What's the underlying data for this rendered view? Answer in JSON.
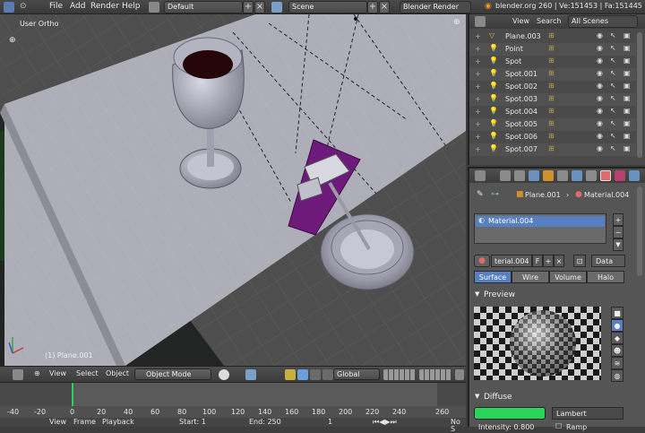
{
  "topbar": {
    "menu": [
      "File",
      "Add",
      "Render",
      "Help"
    ],
    "screen": "Default",
    "scene": "Scene",
    "engine": "Blender Render",
    "stats": "blender.org 260 | Ve:151453 | Fa:151445 | O"
  },
  "viewport": {
    "label": "User Ortho",
    "object_label": "(1) Plane.001"
  },
  "view_toolbar": {
    "items": [
      "View",
      "Select",
      "Object"
    ],
    "mode": "Object Mode",
    "orientation": "Global"
  },
  "timeline": {
    "ticks": [
      "-40",
      "-20",
      "0",
      "20",
      "40",
      "60",
      "80",
      "100",
      "120",
      "140",
      "160",
      "180",
      "200",
      "220",
      "240",
      "260"
    ],
    "items": [
      "View",
      "Frame",
      "Playback"
    ],
    "start": "Start: 1",
    "end": "End: 250",
    "current": "1",
    "no_sync": "No S"
  },
  "outliner": {
    "header": [
      "View",
      "Search"
    ],
    "scenes": "All Scenes",
    "items": [
      "Plane.003",
      "Point",
      "Spot",
      "Spot.001",
      "Spot.002",
      "Spot.003",
      "Spot.004",
      "Spot.005",
      "Spot.006",
      "Spot.007"
    ]
  },
  "properties": {
    "breadcrumb_object": "Plane.001",
    "breadcrumb_material": "Material.004",
    "material_slot": "Material.004",
    "material_name": "terial.004",
    "f_label": "F",
    "data_label": "Data",
    "tabs": [
      "Surface",
      "Wire",
      "Volume",
      "Halo"
    ],
    "preview_title": "Preview",
    "diffuse_title": "Diffuse",
    "diffuse_shader": "Lambert",
    "intensity": "Intensity: 0.800",
    "ramp": "Ramp",
    "diffuse_color": "#2ad45a"
  }
}
